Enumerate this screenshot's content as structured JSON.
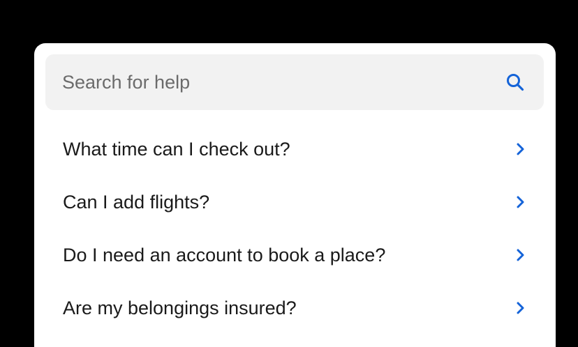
{
  "search": {
    "placeholder": "Search for help",
    "value": ""
  },
  "faq": {
    "items": [
      {
        "label": "What time can I check out?",
        "icon": "chevron-right-icon"
      },
      {
        "label": "Can I add flights?",
        "icon": "chevron-right-icon"
      },
      {
        "label": "Do I need an account to book a place?",
        "icon": "chevron-right-icon"
      },
      {
        "label": "Are my belongings insured?",
        "icon": "chevron-right-icon"
      }
    ]
  },
  "colors": {
    "accent": "#1463d8",
    "background": "#000000",
    "card": "#ffffff",
    "search_bg": "#f2f2f2",
    "text": "#1a1a1a",
    "placeholder": "#6b6b6b"
  },
  "icons": {
    "search": "search-icon"
  }
}
